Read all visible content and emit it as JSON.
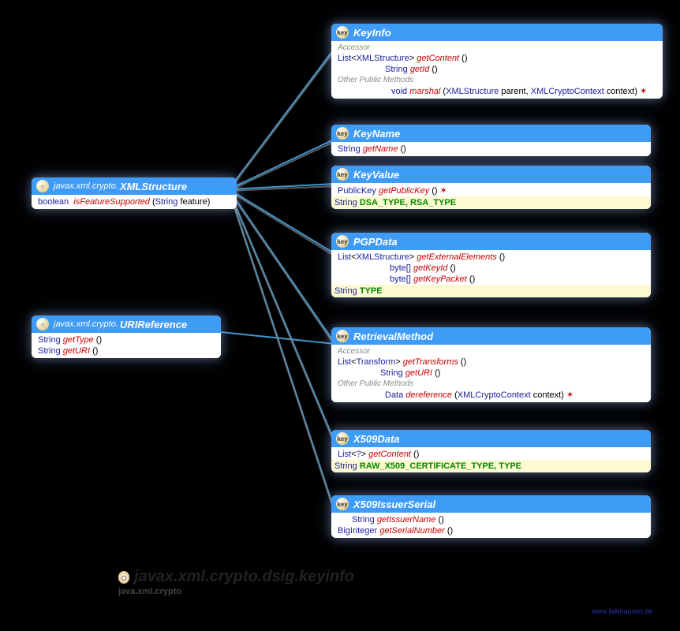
{
  "package_title": "javax.xml.crypto.dsig.keyinfo",
  "package_sub": "java.xml.crypto",
  "watermark": "www.falkhausen.de",
  "xmlstructure": {
    "pkg": "javax.xml.crypto.",
    "name": "XMLStructure",
    "m1_ret": "boolean",
    "m1_name": "isFeatureSupported",
    "m1_p": "String",
    "m1_pn": "feature"
  },
  "urireference": {
    "pkg": "javax.xml.crypto.",
    "name": "URIReference",
    "m1_ret": "String",
    "m1_name": "getType",
    "m2_ret": "String",
    "m2_name": "getURI"
  },
  "keyinfo": {
    "name": "KeyInfo",
    "sec1": "Accessor",
    "m1_ret": "List",
    "m1_gen": "XMLStructure",
    "m1_name": "getContent",
    "m2_ret": "String",
    "m2_name": "getId",
    "sec2": "Other Public Methods",
    "m3_ret": "void",
    "m3_name": "marshal",
    "m3_p1": "XMLStructure",
    "m3_p1n": "parent",
    "m3_p2": "XMLCryptoContext",
    "m3_p2n": "context"
  },
  "keyname": {
    "name": "KeyName",
    "m1_ret": "String",
    "m1_name": "getName"
  },
  "keyvalue": {
    "name": "KeyValue",
    "m1_ret": "PublicKey",
    "m1_name": "getPublicKey",
    "c_type": "String",
    "c_names": "DSA_TYPE, RSA_TYPE"
  },
  "pgpdata": {
    "name": "PGPData",
    "m1_ret": "List",
    "m1_gen": "XMLStructure",
    "m1_name": "getExternalElements",
    "m2_ret": "byte[]",
    "m2_name": "getKeyId",
    "m3_ret": "byte[]",
    "m3_name": "getKeyPacket",
    "c_type": "String",
    "c_names": "TYPE"
  },
  "retrievalmethod": {
    "name": "RetrievalMethod",
    "sec1": "Accessor",
    "m1_ret": "List",
    "m1_gen": "Transform",
    "m1_name": "getTransforms",
    "m2_ret": "String",
    "m2_name": "getURI",
    "sec2": "Other Public Methods",
    "m3_ret": "Data",
    "m3_name": "dereference",
    "m3_p1": "XMLCryptoContext",
    "m3_p1n": "context"
  },
  "x509data": {
    "name": "X509Data",
    "m1_ret": "List",
    "m1_gen": "?",
    "m1_name": "getContent",
    "c_type": "String",
    "c_names": "RAW_X509_CERTIFICATE_TYPE, TYPE"
  },
  "x509issuer": {
    "name": "X509IssuerSerial",
    "m1_ret": "String",
    "m1_name": "getIssuerName",
    "m2_ret": "BigInteger",
    "m2_name": "getSerialNumber"
  }
}
